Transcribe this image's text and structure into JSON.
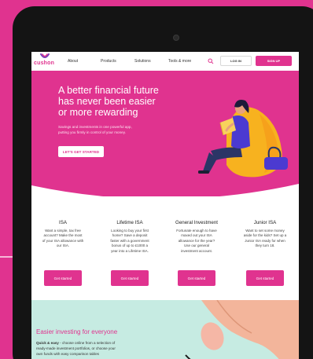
{
  "nav": {
    "logo_text": "cushon",
    "links": [
      "About",
      "Products",
      "Solutions",
      "Tools & more"
    ],
    "login_label": "LOG IN",
    "signup_label": "SIGN UP"
  },
  "hero": {
    "title_line1": "A better financial future",
    "title_line2": "has never been easier",
    "title_line3": "or more rewarding",
    "sub_line1": "Savings and investments in one powerful app,",
    "sub_line2": "putting you firmly in control of your money.",
    "cta_label": "LET'S GET STARTED"
  },
  "products": [
    {
      "title": "ISA",
      "lines": [
        "Want a simple, tax free",
        "account? Make the most",
        "of your ISA allowance with",
        "our ISA."
      ],
      "button": "Get started"
    },
    {
      "title": "Lifetime ISA",
      "lines": [
        "Looking to buy your first",
        "home? Save a deposit",
        "faster with a government",
        "bonus of up to £1000 a",
        "year into a Lifetime ISA."
      ],
      "button": "Get started"
    },
    {
      "title": "General Investment",
      "lines": [
        "Fortunate enough to have",
        "maxed out your ISA",
        "allowance for the year?",
        "Use our general",
        "investment account."
      ],
      "button": "Get started"
    },
    {
      "title": "Junior ISA",
      "lines": [
        "Want to set some money",
        "aside for the kids? Set up a",
        "Junior ISA ready for when",
        "they turn 18."
      ],
      "button": "Get started"
    }
  ],
  "band": {
    "title": "Easier investing for everyone",
    "bold_lead": "Quick & easy",
    "line1_rest": " - choose online from a selection of",
    "line2": "ready-made investment portfolios, or choose your",
    "line3": "own funds with easy comparison tables"
  },
  "colors": {
    "brand": "#e0338f",
    "band_bg": "#c6ebe2",
    "device": "#141414"
  }
}
